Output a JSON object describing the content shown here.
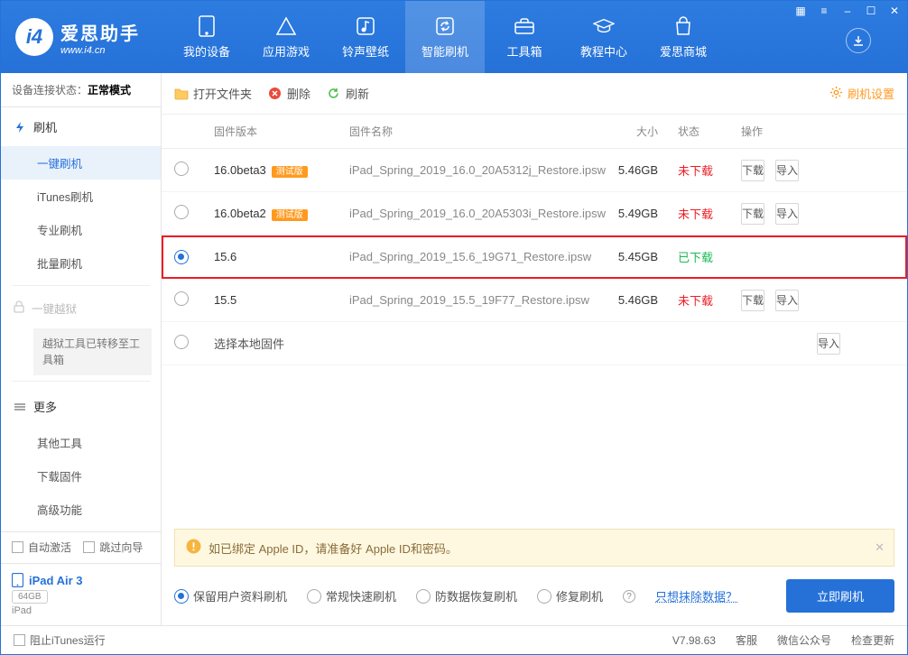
{
  "brand": {
    "name": "爱思助手",
    "url": "www.i4.cn"
  },
  "nav": {
    "items": [
      {
        "label": "我的设备"
      },
      {
        "label": "应用游戏"
      },
      {
        "label": "铃声壁纸"
      },
      {
        "label": "智能刷机"
      },
      {
        "label": "工具箱"
      },
      {
        "label": "教程中心"
      },
      {
        "label": "爱思商城"
      }
    ]
  },
  "status": {
    "prefix": "设备连接状态：",
    "mode": "正常模式"
  },
  "sidebar": {
    "flash": {
      "label": "刷机"
    },
    "subs": [
      {
        "label": "一键刷机"
      },
      {
        "label": "iTunes刷机"
      },
      {
        "label": "专业刷机"
      },
      {
        "label": "批量刷机"
      }
    ],
    "jailbreak": {
      "label": "一键越狱"
    },
    "jailbreak_note": "越狱工具已转移至工具箱",
    "more": {
      "label": "更多"
    },
    "more_subs": [
      {
        "label": "其他工具"
      },
      {
        "label": "下载固件"
      },
      {
        "label": "高级功能"
      }
    ],
    "auto_activate": "自动激活",
    "skip_guide": "跳过向导"
  },
  "device": {
    "name": "iPad Air 3",
    "storage": "64GB",
    "type": "iPad"
  },
  "toolbar": {
    "open": "打开文件夹",
    "delete": "删除",
    "refresh": "刷新",
    "settings": "刷机设置"
  },
  "table": {
    "headers": {
      "version": "固件版本",
      "name": "固件名称",
      "size": "大小",
      "status": "状态",
      "ops": "操作"
    },
    "rows": [
      {
        "version": "16.0beta3",
        "beta": "测试版",
        "name": "iPad_Spring_2019_16.0_20A5312j_Restore.ipsw",
        "size": "5.46GB",
        "status": "未下载",
        "status_cls": "not",
        "selected": false,
        "highlighted": false,
        "show_ops": true
      },
      {
        "version": "16.0beta2",
        "beta": "测试版",
        "name": "iPad_Spring_2019_16.0_20A5303i_Restore.ipsw",
        "size": "5.49GB",
        "status": "未下载",
        "status_cls": "not",
        "selected": false,
        "highlighted": false,
        "show_ops": true
      },
      {
        "version": "15.6",
        "beta": "",
        "name": "iPad_Spring_2019_15.6_19G71_Restore.ipsw",
        "size": "5.45GB",
        "status": "已下载",
        "status_cls": "done",
        "selected": true,
        "highlighted": true,
        "show_ops": false
      },
      {
        "version": "15.5",
        "beta": "",
        "name": "iPad_Spring_2019_15.5_19F77_Restore.ipsw",
        "size": "5.46GB",
        "status": "未下载",
        "status_cls": "not",
        "selected": false,
        "highlighted": false,
        "show_ops": true
      }
    ],
    "choose_local": "选择本地固件",
    "download": "下载",
    "import": "导入"
  },
  "warning": {
    "text": "如已绑定 Apple ID，请准备好 Apple ID和密码。"
  },
  "options": {
    "opts": [
      {
        "label": "保留用户资料刷机",
        "selected": true
      },
      {
        "label": "常规快速刷机",
        "selected": false
      },
      {
        "label": "防数据恢复刷机",
        "selected": false
      },
      {
        "label": "修复刷机",
        "selected": false
      }
    ],
    "erase_link": "只想抹除数据？",
    "go": "立即刷机"
  },
  "footer": {
    "block_itunes": "阻止iTunes运行",
    "version": "V7.98.63",
    "service": "客服",
    "wechat": "微信公众号",
    "update": "检查更新"
  }
}
